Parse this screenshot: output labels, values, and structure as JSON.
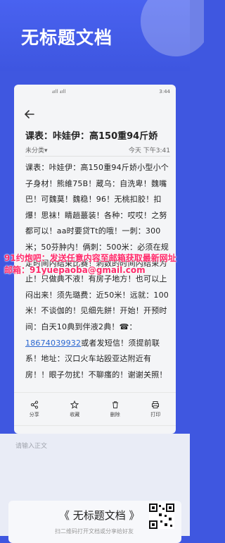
{
  "app": {
    "title": "无标题文档"
  },
  "status_bar": {
    "signal": "₄ıll ₄ıll",
    "time": "3:44"
  },
  "document": {
    "title": "课表：咔娃伊：高150重94斤娇",
    "category": "未分类▾",
    "timestamp": "今天 下午3:41",
    "body_pre": "课表：咔娃伊：高150重94斤娇小型小个子身材！熊維75B！蔵乌：自洗卑！魏嘴巴！可魏莫！魏稳！96！无桃扣胶！扣爆！思袜！睛趟蕞装！各种：哎哎！之努都可以！aa时要贷Tt的哦！一刺：300米；50芬肿内！俩刺：500米：必须在规定时间內结束比赛！刺数的时间内结束为止！只做典不液！有房子地方！也可以上闷出来！须先璐费：近50米！远就：100米！不谈伽的！见细先餅！开始！开预时间：白天10典到伴液2典！☎：",
    "phone": "18674039932",
    "body_post": "或者发短信！须提前联系！地址：汉口火车站殴亚达附近有房！！眼子勿扰！不聊瘙的！谢谢关照！"
  },
  "actions": [
    {
      "label": "分享",
      "icon": "share-icon"
    },
    {
      "label": "收藏",
      "icon": "star-icon"
    },
    {
      "label": "删除",
      "icon": "trash-icon"
    },
    {
      "label": "打印",
      "icon": "printer-icon"
    }
  ],
  "input": {
    "placeholder": "请输入正文"
  },
  "footer": {
    "title": "《 无标题文档 》",
    "subtitle": "扫二维码打开文档或分享给好友"
  },
  "overlay": {
    "line1": "91约炮吧：发送任意内容至邮箱获取最新网址",
    "line2": "邮箱：91yuepaoba@gmail.com"
  },
  "colors": {
    "brand": "#3f57e0",
    "overlay": "#ff2a6a",
    "link": "#2a66d0"
  }
}
